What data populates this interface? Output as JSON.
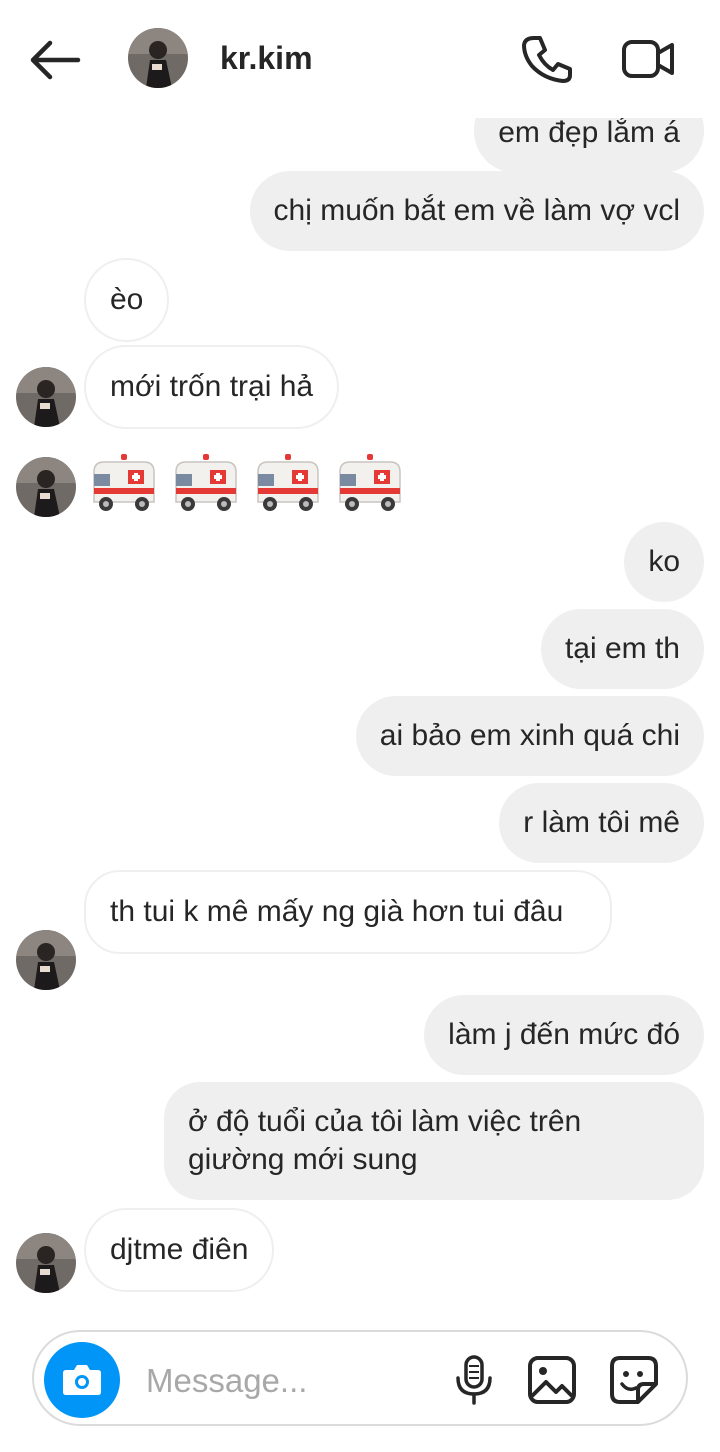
{
  "header": {
    "username": "kr.kim",
    "back_icon": "arrow-left-icon",
    "call_icon": "phone-icon",
    "video_icon": "video-camera-icon"
  },
  "messages": [
    {
      "side": "out",
      "text": "em đẹp lắm á"
    },
    {
      "side": "out",
      "text": "chị muốn bắt em về làm vợ vcl"
    },
    {
      "side": "in",
      "text": "èo"
    },
    {
      "side": "in",
      "text": "mới trốn trại hả"
    },
    {
      "side": "in",
      "text": "🚑🚑🚑🚑",
      "emoji": "ambulance"
    },
    {
      "side": "out",
      "text": "ko"
    },
    {
      "side": "out",
      "text": "tại em th"
    },
    {
      "side": "out",
      "text": "ai bảo em xinh quá chi"
    },
    {
      "side": "out",
      "text": "r làm tôi mê"
    },
    {
      "side": "in",
      "text": "th tui k mê mấy ng già hơn tui đâu"
    },
    {
      "side": "out",
      "text": "làm j đến mức đó"
    },
    {
      "side": "out",
      "text": "ở độ tuổi của tôi làm việc trên giường mới sung"
    },
    {
      "side": "in",
      "text": "djtme điên"
    }
  ],
  "composer": {
    "placeholder": "Message...",
    "camera_icon": "camera-icon",
    "mic_icon": "microphone-icon",
    "gallery_icon": "image-icon",
    "sticker_icon": "sticker-icon"
  },
  "colors": {
    "outgoing_bubble": "#efefef",
    "incoming_border": "#efefef",
    "camera_button": "#0095f6",
    "text": "#262626",
    "placeholder": "#a8a8a8"
  }
}
